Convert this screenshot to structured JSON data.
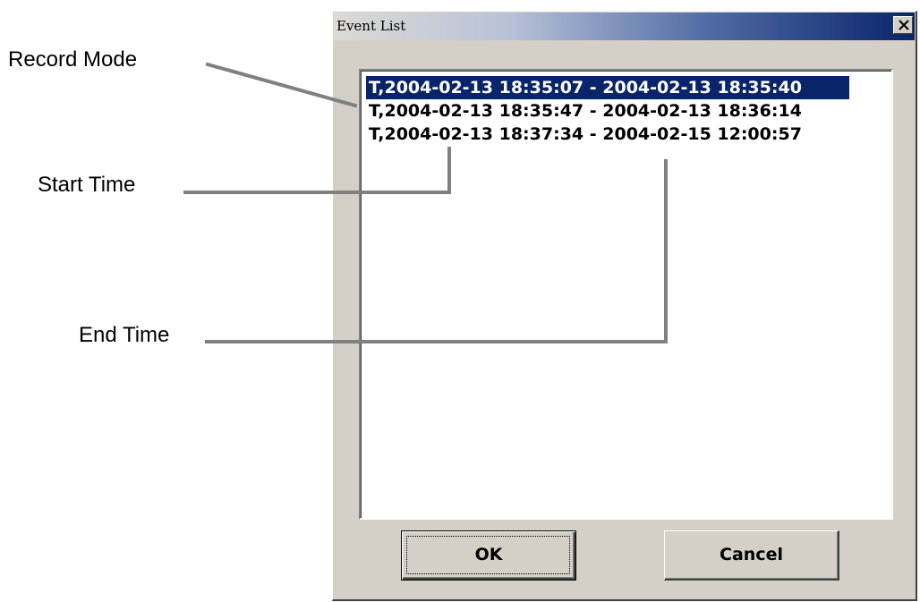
{
  "annotations": {
    "record_mode": "Record Mode",
    "start_time": "Start Time",
    "end_time": "End Time"
  },
  "dialog": {
    "title": "Event List",
    "close_icon": "close-x-icon",
    "events": [
      "T,2004-02-13 18:35:07 - 2004-02-13 18:35:40",
      "T,2004-02-13 18:35:47 - 2004-02-13 18:36:14",
      "T,2004-02-13 18:37:34 - 2004-02-15 12:00:57"
    ],
    "selected_index": 0,
    "buttons": {
      "ok": "OK",
      "cancel": "Cancel"
    }
  },
  "colors": {
    "title_gradient_end": "#0a246a",
    "selection": "#0a246a",
    "dialog_face": "#d4d0c8",
    "leader_line": "#808080"
  }
}
